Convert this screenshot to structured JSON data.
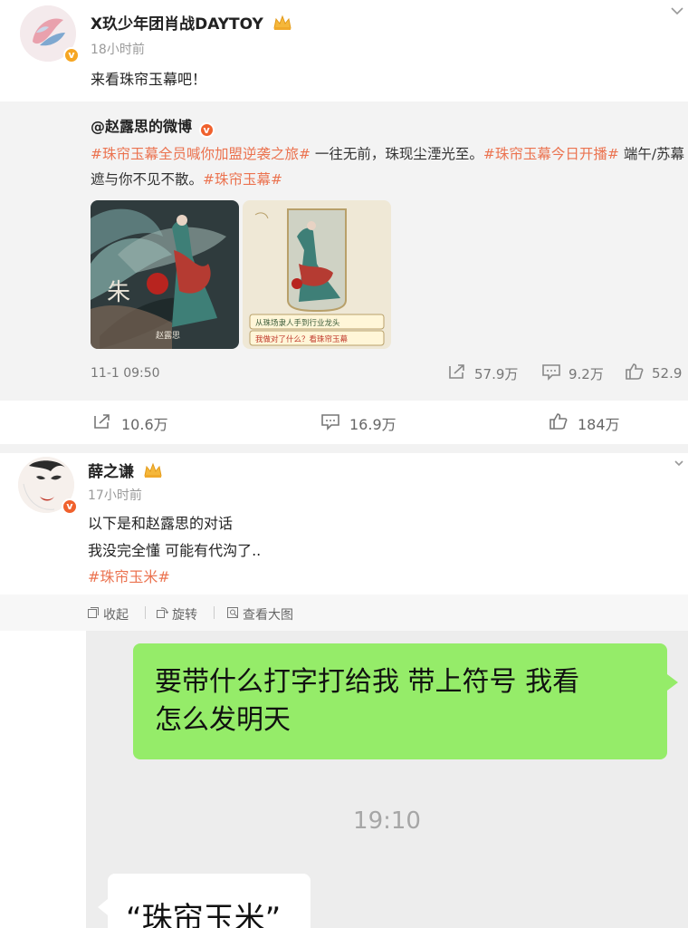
{
  "post1": {
    "author": "X玖少年团肖战DAYTOY",
    "time": "18小时前",
    "text": "来看珠帘玉幕吧！",
    "repost": {
      "author": "@赵露思的微博",
      "tag1": "#珠帘玉幕全员喊你加盟逆袭之旅#",
      "text1": " 一往无前，珠现尘湮光至。",
      "tag2": "#珠帘玉幕今日开播#",
      "text2": " 端午/苏幕遮与你不见不散。",
      "tag3": "#珠帘玉幕#",
      "poster1_name": "赵露思",
      "poster2_line1": "从珠场隶人手到行业龙头",
      "poster2_line2": "我做对了什么？看珠帘玉幕",
      "date": "11-1 09:50",
      "shares": "57.9万",
      "comments": "9.2万",
      "likes": "52.9"
    },
    "stats": {
      "shares": "10.6万",
      "comments": "16.9万",
      "likes": "184万"
    }
  },
  "post2": {
    "author": "薛之谦",
    "time": "17小时前",
    "line1": "以下是和赵露思的对话",
    "line2": "我没完全懂 可能有代沟了..",
    "tag": "#珠帘玉米#",
    "image_actions": {
      "collapse": "收起",
      "rotate": "旋转",
      "view_large": "查看大图"
    },
    "chat": {
      "my_message_line1": "要带什么打字打给我 带上符号 我看",
      "my_message_line2": "怎么发明天",
      "time": "19:10",
      "reply": "“珠帘玉米”"
    }
  },
  "colors": {
    "tag": "#eb7350",
    "vip_badge": "#f6a623",
    "chat_green": "#95ec69"
  },
  "icons": [
    "chevron-down-icon",
    "crown-icon",
    "verified-icon",
    "share-icon",
    "comment-icon",
    "like-icon",
    "collapse-icon",
    "rotate-icon",
    "view-large-icon"
  ]
}
